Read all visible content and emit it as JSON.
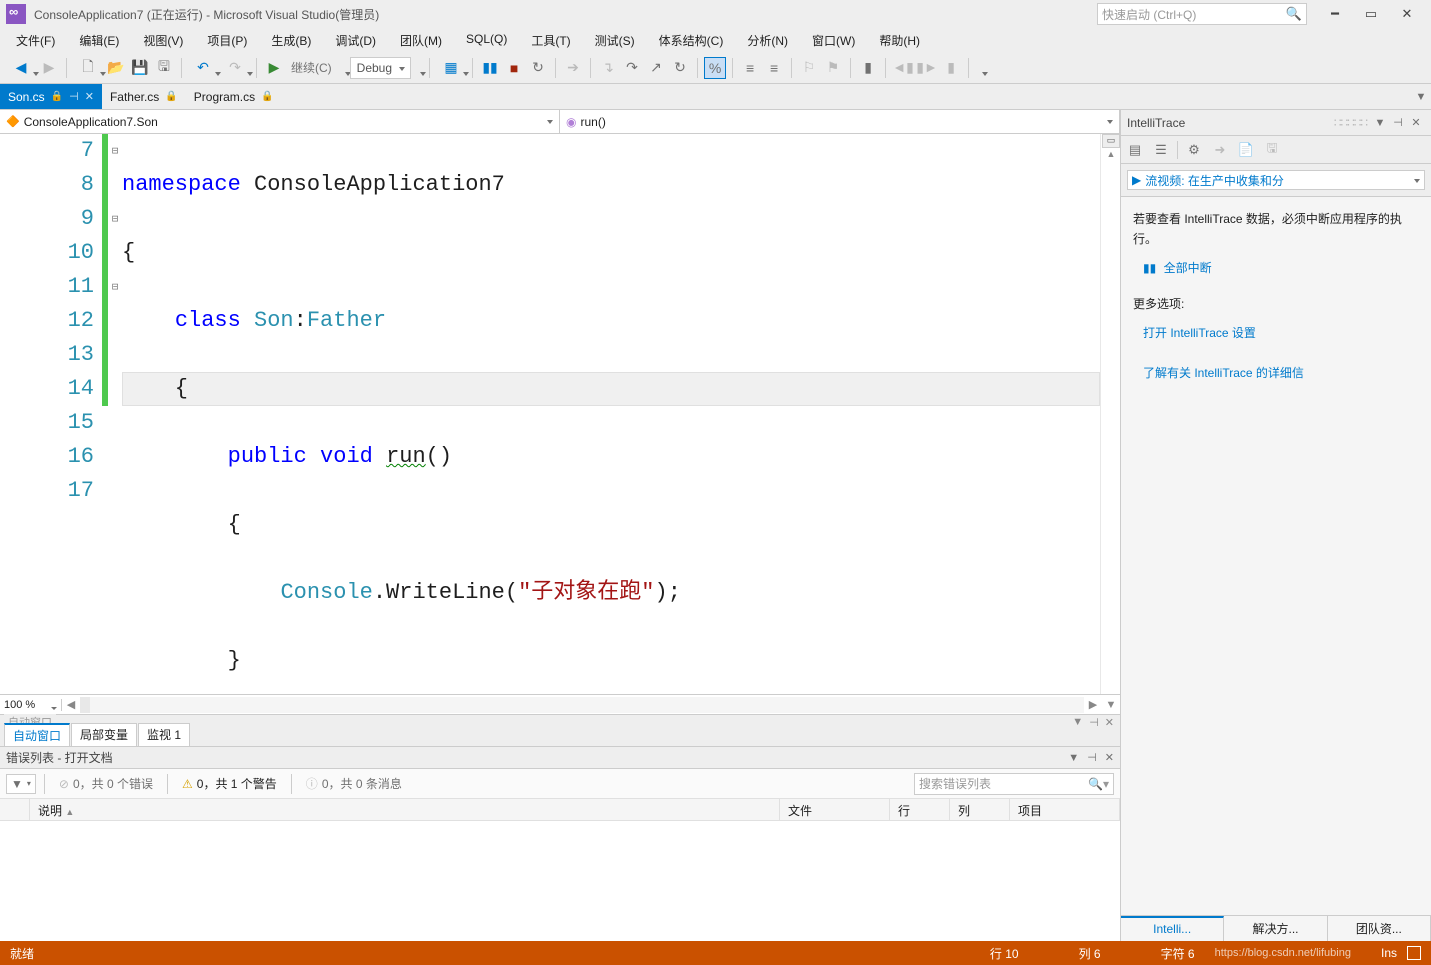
{
  "titlebar": {
    "title": "ConsoleApplication7 (正在运行) - Microsoft Visual Studio(管理员)",
    "search_placeholder": "快速启动 (Ctrl+Q)"
  },
  "menu": {
    "file": "文件(F)",
    "edit": "编辑(E)",
    "view": "视图(V)",
    "project": "项目(P)",
    "build": "生成(B)",
    "debug": "调试(D)",
    "team": "团队(M)",
    "sql": "SQL(Q)",
    "tools": "工具(T)",
    "test": "测试(S)",
    "arch": "体系结构(C)",
    "analyze": "分析(N)",
    "window": "窗口(W)",
    "help": "帮助(H)"
  },
  "toolbar": {
    "continue": "继续(C)",
    "config": "Debug"
  },
  "doctabs": {
    "t0": "Son.cs",
    "t1": "Father.cs",
    "t2": "Program.cs"
  },
  "navbar": {
    "left": "ConsoleApplication7.Son",
    "right": "run()"
  },
  "code": {
    "lines": {
      "l7": "7",
      "l8": "8",
      "l9": "9",
      "l10": "10",
      "l11": "11",
      "l12": "12",
      "l13": "13",
      "l14": "14",
      "l15": "15",
      "l16": "16",
      "l17": "17"
    },
    "t7a": "namespace",
    "t7b": " ConsoleApplication7",
    "t8": "{",
    "t9a": "    ",
    "t9b": "class",
    "t9c": " ",
    "t9d": "Son",
    "t9e": ":",
    "t9f": "Father",
    "t10": "    {",
    "t11a": "        ",
    "t11b": "public",
    "t11c": " ",
    "t11d": "void",
    "t11e": " ",
    "t11f": "run",
    "t11g": "()",
    "t12": "        {",
    "t13a": "            ",
    "t13b": "Console",
    "t13c": ".WriteLine(",
    "t13d": "\"子对象在跑\"",
    "t13e": ");",
    "t14": "        }",
    "t15": "    }",
    "t16": "}",
    "t17": ""
  },
  "zoom": "100 %",
  "autopanel": {
    "title": "自动窗口",
    "tab0": "自动窗口",
    "tab1": "局部变量",
    "tab2": "监视 1"
  },
  "errorpanel": {
    "title": "错误列表 - 打开文档",
    "err": "0，共 0 个错误",
    "warn": "0，共 1 个警告",
    "info": "0，共 0 条消息",
    "search_placeholder": "搜索错误列表",
    "col_desc": "说明",
    "col_file": "文件",
    "col_line": "行",
    "col_col": "列",
    "col_proj": "项目"
  },
  "intellitrace": {
    "title": "IntelliTrace",
    "video": "流视频: 在生产中收集和分",
    "msg1": "若要查看 IntelliTrace 数据，必须中断应用程序的执行。",
    "break": "全部中断",
    "more": "更多选项:",
    "link1": "打开 IntelliTrace 设置",
    "link2": "了解有关 IntelliTrace 的详细信",
    "tab0": "Intelli...",
    "tab1": "解决方...",
    "tab2": "团队资..."
  },
  "status": {
    "ready": "就绪",
    "line": "行 10",
    "col": "列 6",
    "char": "字符 6",
    "ins": "Ins",
    "watermark": "https://blog.csdn.net/lifubing"
  }
}
